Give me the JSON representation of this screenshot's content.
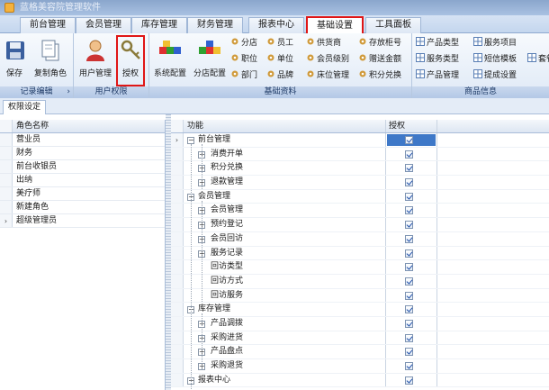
{
  "window": {
    "title": "蓝格美容院管理软件"
  },
  "tabs": [
    {
      "label": "前台管理"
    },
    {
      "label": "会员管理"
    },
    {
      "label": "库存管理"
    },
    {
      "label": "财务管理"
    },
    {
      "label": "报表中心"
    },
    {
      "label": "基础设置"
    },
    {
      "label": "工具面板"
    }
  ],
  "ribbon": {
    "record_group": {
      "label": "记录编辑",
      "save": "保存",
      "copy_role": "复制角色"
    },
    "user_group": {
      "label": "用户权限",
      "user_mgmt": "用户管理",
      "authorize": "授权"
    },
    "basic_group": {
      "label": "基础资料",
      "system_config": "系统配置",
      "branch_config": "分店配置",
      "items": [
        "分店",
        "员工",
        "供货商",
        "存放柜号",
        "职位",
        "单位",
        "会员级别",
        "赠送金额",
        "部门",
        "品牌",
        "床位管理",
        "积分兑换"
      ]
    },
    "goods_group": {
      "label": "商品信息",
      "items": [
        "产品类型",
        "服务项目",
        "服务类型",
        "短信模板",
        "套餐",
        "产品管理",
        "提成设置"
      ]
    }
  },
  "panel_tab": "权限设定",
  "roles": {
    "header": "角色名称",
    "rows": [
      "营业员",
      "财务",
      "前台收银员",
      "出纳",
      "美疗师",
      "新建角色",
      "超级管理员"
    ]
  },
  "permissions": {
    "header_function": "功能",
    "header_grant": "授权",
    "rows": [
      {
        "label": "前台管理"
      },
      {
        "label": "消费开单"
      },
      {
        "label": "积分兑换"
      },
      {
        "label": "退款管理"
      },
      {
        "label": "会员管理"
      },
      {
        "label": "会员管理"
      },
      {
        "label": "预约登记"
      },
      {
        "label": "会员回访"
      },
      {
        "label": "服务记录"
      },
      {
        "label": "回访类型"
      },
      {
        "label": "回访方式"
      },
      {
        "label": "回访服务"
      },
      {
        "label": "库存管理"
      },
      {
        "label": "产品调拨"
      },
      {
        "label": "采购进货"
      },
      {
        "label": "产品盘点"
      },
      {
        "label": "采购退货"
      },
      {
        "label": "报表中心"
      }
    ]
  },
  "colors": {
    "highlight": "#e01616",
    "accent": "#1f4fa8"
  }
}
